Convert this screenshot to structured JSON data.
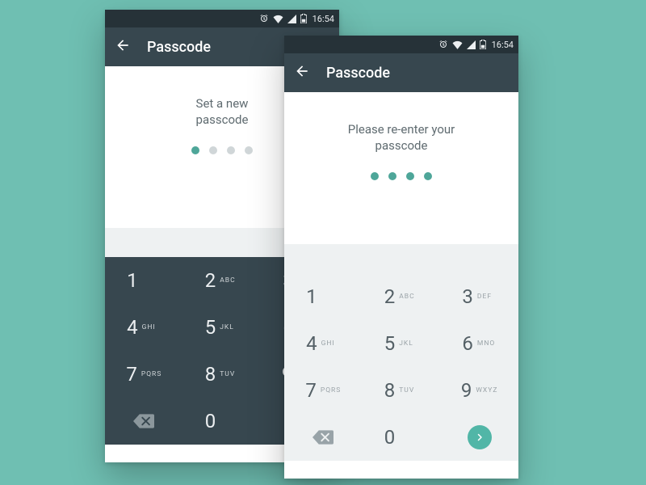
{
  "status": {
    "time": "16:54"
  },
  "appbar": {
    "title": "Passcode"
  },
  "colors": {
    "accent": "#4ea699",
    "go_btn": "#51b6a7"
  },
  "screens": {
    "a": {
      "prompt": "Set a new\npasscode",
      "dots_filled": 1,
      "dots_total": 4,
      "keypad_theme": "dark",
      "show_go": false
    },
    "b": {
      "prompt": "Please re-enter your\npasscode",
      "dots_filled": 4,
      "dots_total": 4,
      "keypad_theme": "light",
      "show_go": true
    }
  },
  "keypad": {
    "rows": [
      [
        {
          "d": "1",
          "l": ""
        },
        {
          "d": "2",
          "l": "ABC"
        },
        {
          "d": "3",
          "l": "DEF"
        }
      ],
      [
        {
          "d": "4",
          "l": "GHI"
        },
        {
          "d": "5",
          "l": "JKL"
        },
        {
          "d": "6",
          "l": "MNO"
        }
      ],
      [
        {
          "d": "7",
          "l": "PQRS"
        },
        {
          "d": "8",
          "l": "TUV"
        },
        {
          "d": "9",
          "l": "WXYZ"
        }
      ]
    ],
    "zero": {
      "d": "0",
      "l": ""
    }
  }
}
